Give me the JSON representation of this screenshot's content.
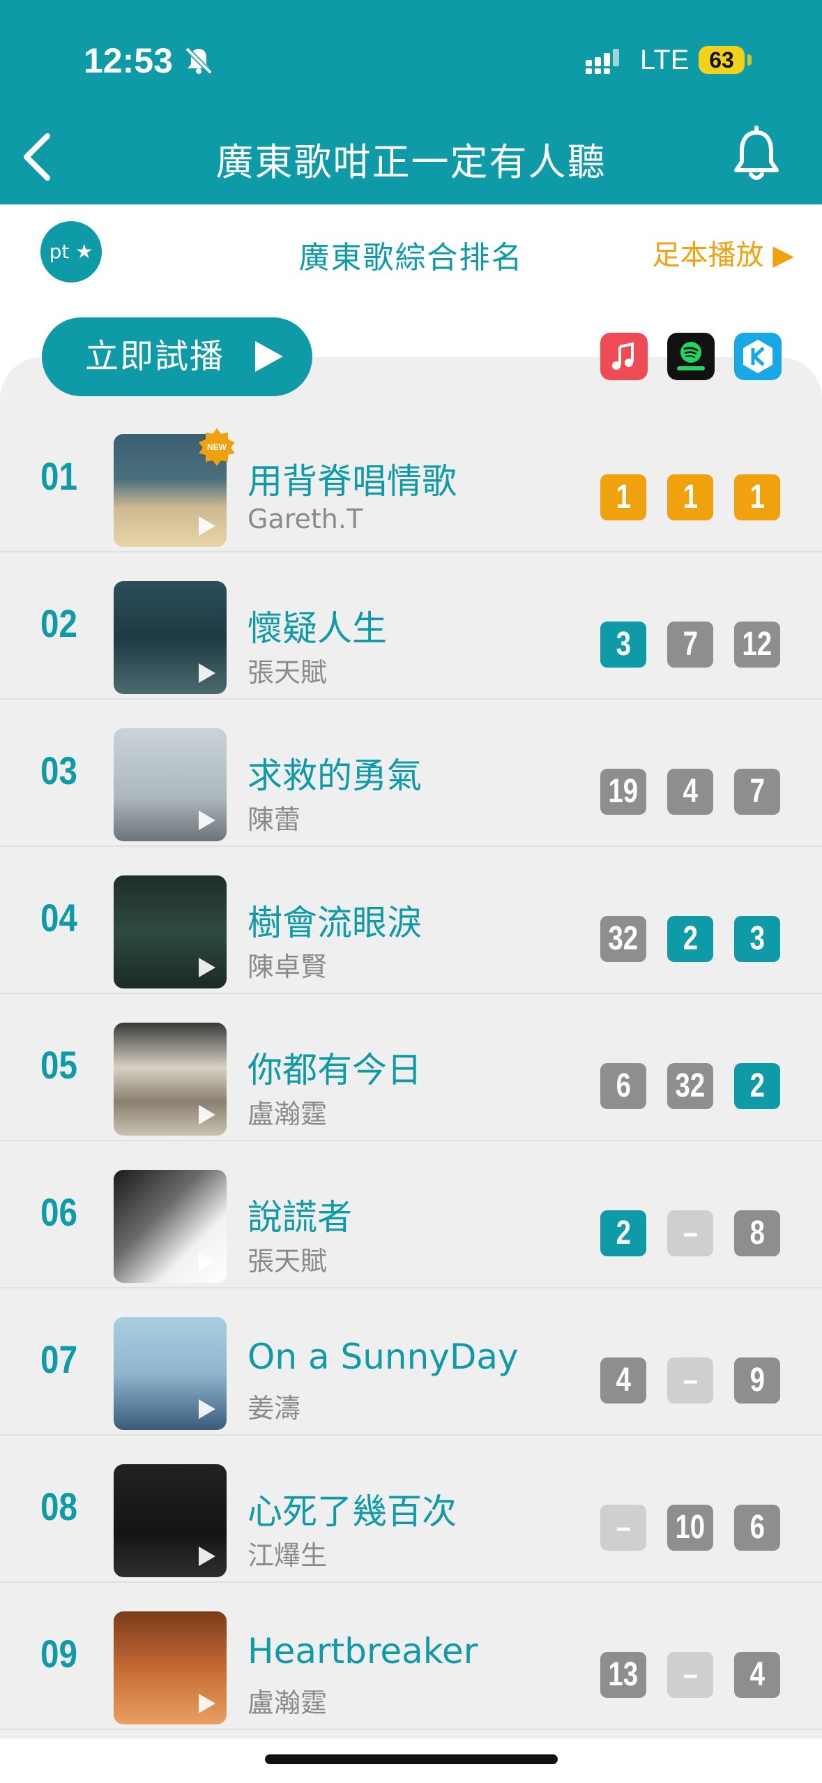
{
  "status_bar": {
    "time": "12:53",
    "network": "LTE",
    "battery": "63"
  },
  "header": {
    "title": "廣東歌咁正一定有人聽"
  },
  "subbar": {
    "badge": "pt",
    "title": "廣東歌綜合排名",
    "full_play": "足本播放 ▶"
  },
  "try_play": {
    "label": "立即試播"
  },
  "platforms": [
    "apple-music",
    "spotify",
    "kkbox"
  ],
  "colors": {
    "accent": "#0e9aa6",
    "orange": "#f0a20e",
    "gray": "#8e8e8e",
    "light": "#cfcfcf"
  },
  "songs": [
    {
      "rank": "01",
      "title": "用背脊唱情歌",
      "artist": "Gareth.T",
      "new": true,
      "ranks": [
        {
          "v": "1",
          "s": "orange"
        },
        {
          "v": "1",
          "s": "orange"
        },
        {
          "v": "1",
          "s": "orange"
        }
      ]
    },
    {
      "rank": "02",
      "title": "懷疑人生",
      "artist": "張天賦",
      "ranks": [
        {
          "v": "3",
          "s": "teal"
        },
        {
          "v": "7",
          "s": "gray"
        },
        {
          "v": "12",
          "s": "gray"
        }
      ]
    },
    {
      "rank": "03",
      "title": "求救的勇氣",
      "artist": "陳蕾",
      "ranks": [
        {
          "v": "19",
          "s": "gray"
        },
        {
          "v": "4",
          "s": "gray"
        },
        {
          "v": "7",
          "s": "gray"
        }
      ]
    },
    {
      "rank": "04",
      "title": "樹會流眼淚",
      "artist": "陳卓賢",
      "ranks": [
        {
          "v": "32",
          "s": "gray"
        },
        {
          "v": "2",
          "s": "teal"
        },
        {
          "v": "3",
          "s": "teal"
        }
      ]
    },
    {
      "rank": "05",
      "title": "你都有今日",
      "artist": "盧瀚霆",
      "ranks": [
        {
          "v": "6",
          "s": "gray"
        },
        {
          "v": "32",
          "s": "gray"
        },
        {
          "v": "2",
          "s": "teal"
        }
      ]
    },
    {
      "rank": "06",
      "title": "說謊者",
      "artist": "張天賦",
      "ranks": [
        {
          "v": "2",
          "s": "teal"
        },
        {
          "v": "–",
          "s": "light"
        },
        {
          "v": "8",
          "s": "gray"
        }
      ]
    },
    {
      "rank": "07",
      "title": "On a SunnyDay",
      "artist": "姜濤",
      "ranks": [
        {
          "v": "4",
          "s": "gray"
        },
        {
          "v": "–",
          "s": "light"
        },
        {
          "v": "9",
          "s": "gray"
        }
      ]
    },
    {
      "rank": "08",
      "title": "心死了幾百次",
      "artist": "江𤒹生",
      "ranks": [
        {
          "v": "–",
          "s": "light"
        },
        {
          "v": "10",
          "s": "gray"
        },
        {
          "v": "6",
          "s": "gray"
        }
      ]
    },
    {
      "rank": "09",
      "title": "Heartbreaker",
      "artist": "盧瀚霆",
      "ranks": [
        {
          "v": "13",
          "s": "gray"
        },
        {
          "v": "–",
          "s": "light"
        },
        {
          "v": "4",
          "s": "gray"
        }
      ]
    }
  ]
}
